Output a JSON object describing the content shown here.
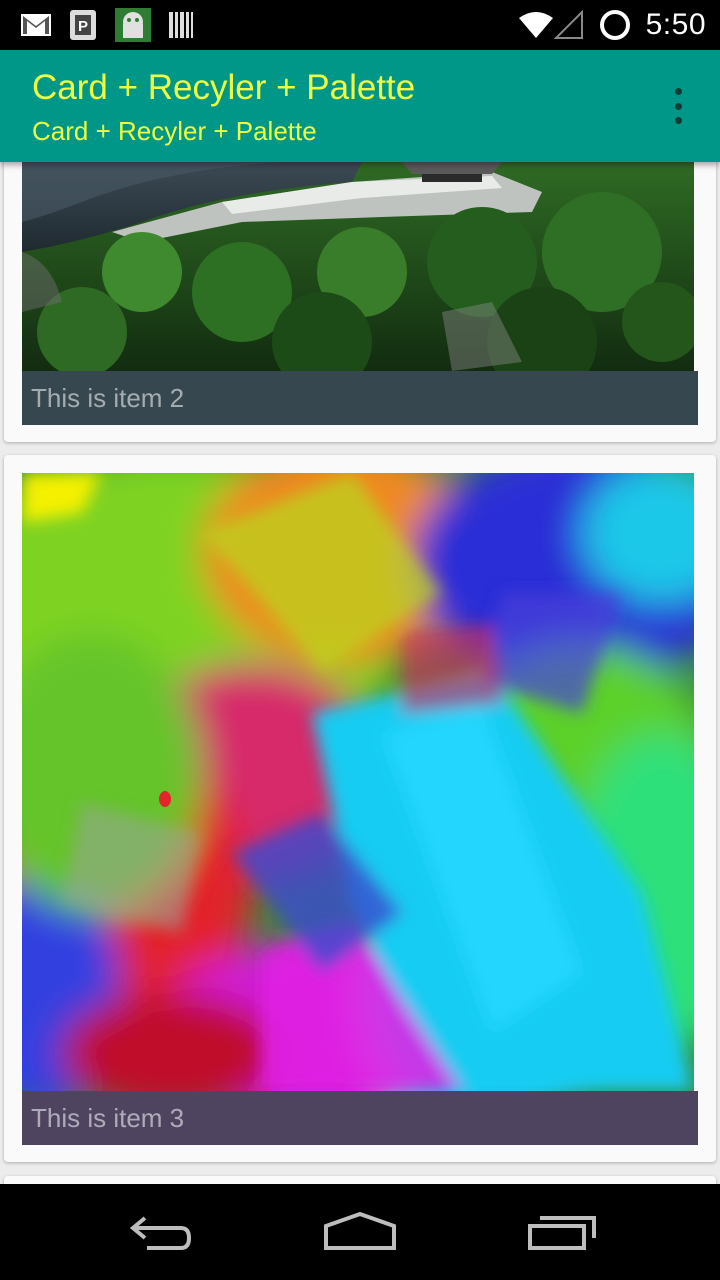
{
  "status_bar": {
    "time": "5:50",
    "icons": [
      "gmail-icon",
      "parking-app-icon",
      "android-app-icon",
      "barcode-icon",
      "wifi-icon",
      "signal-icon",
      "sync-circle-icon"
    ]
  },
  "toolbar": {
    "title": "Card + Recyler + Palette",
    "subtitle": "Card + Recyler + Palette",
    "overflow_icon": "more-vert-icon",
    "background": "#009688",
    "text_color": "#eeff41"
  },
  "list": {
    "items": [
      {
        "label": "This is item 2",
        "caption_color": "#37474f",
        "image": "aerial-landscape-photo"
      },
      {
        "label": "This is item 3",
        "caption_color": "#4e4460",
        "image": "color-paint-splash"
      }
    ]
  },
  "nav_bar": {
    "buttons": [
      "back-icon",
      "home-icon",
      "recents-icon"
    ]
  }
}
